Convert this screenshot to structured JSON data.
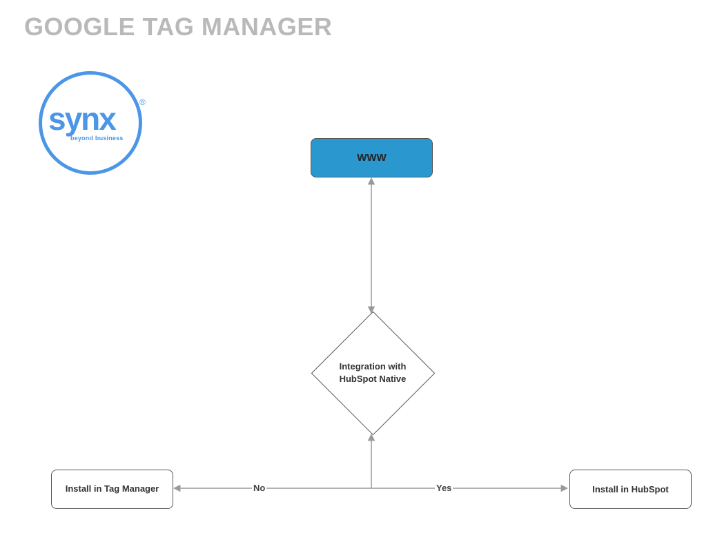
{
  "title": "GOOGLE TAG MANAGER",
  "logo": {
    "brand": "synx",
    "tagline": "beyond business",
    "registered": "®"
  },
  "nodes": {
    "www": {
      "label": "WWW",
      "type": "process",
      "color": "#2a97cf"
    },
    "decision": {
      "label": "Integration with HubSpot Native",
      "type": "decision"
    },
    "installTag": {
      "label": "Install in Tag Manager",
      "type": "process"
    },
    "installHubspot": {
      "label": "Install in HubSpot",
      "type": "process"
    }
  },
  "edges": {
    "no": {
      "label": "No",
      "from": "decision",
      "to": "installTag"
    },
    "yes": {
      "label": "Yes",
      "from": "decision",
      "to": "installHubspot"
    },
    "up": {
      "label": "",
      "from": "decision",
      "to": "www"
    }
  },
  "colors": {
    "accent": "#4b96e6",
    "wwwFill": "#2a97cf",
    "title": "#b9b9b9",
    "arrow": "#999999"
  }
}
